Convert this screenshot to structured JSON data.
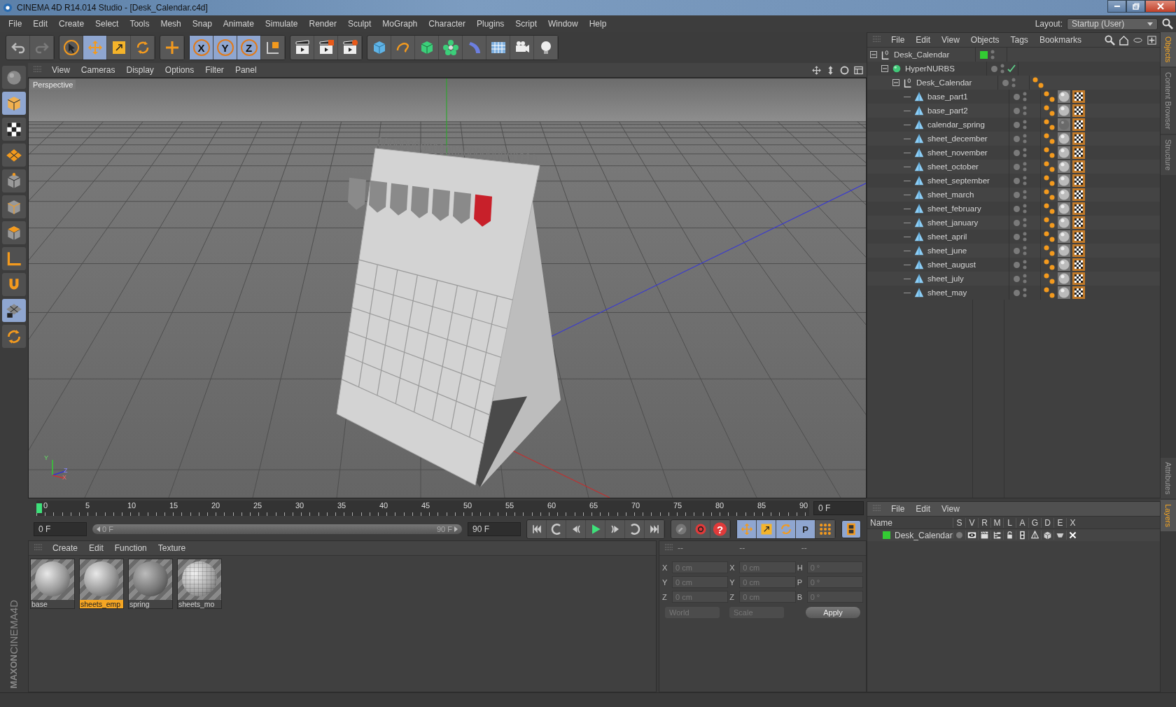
{
  "window": {
    "title": "CINEMA 4D R14.014 Studio - [Desk_Calendar.c4d]"
  },
  "menu_bar": [
    "File",
    "Edit",
    "Create",
    "Select",
    "Tools",
    "Mesh",
    "Snap",
    "Animate",
    "Simulate",
    "Render",
    "Sculpt",
    "MoGraph",
    "Character",
    "Plugins",
    "Script",
    "Window",
    "Help"
  ],
  "layout": {
    "label": "Layout:",
    "value": "Startup (User)"
  },
  "toolbar": [
    {
      "tools": [
        {
          "kind": "undo",
          "disabled": false
        },
        {
          "kind": "redo",
          "disabled": true
        }
      ]
    },
    {
      "tools": [
        {
          "kind": "select",
          "selected": false
        },
        {
          "kind": "move",
          "selected": true
        },
        {
          "kind": "scale",
          "selected": false
        },
        {
          "kind": "rotate",
          "selected": false
        }
      ]
    },
    {
      "tools": [
        {
          "kind": "add",
          "selected": false
        }
      ]
    },
    {
      "tools": [
        {
          "kind": "axis",
          "label": "X",
          "selected": true
        },
        {
          "kind": "axis",
          "label": "Y",
          "selected": true
        },
        {
          "kind": "axis",
          "label": "Z",
          "selected": true
        },
        {
          "kind": "coords",
          "selected": false
        }
      ]
    },
    {
      "tools": [
        {
          "kind": "render-view",
          "selected": false
        },
        {
          "kind": "render-picture",
          "selected": false
        },
        {
          "kind": "render-settings",
          "selected": false
        }
      ]
    },
    {
      "tools": [
        {
          "kind": "cube",
          "selected": false
        },
        {
          "kind": "spline",
          "selected": false
        },
        {
          "kind": "nurbs",
          "selected": false
        },
        {
          "kind": "array",
          "selected": false
        },
        {
          "kind": "deformer",
          "selected": false
        },
        {
          "kind": "floor",
          "selected": false
        },
        {
          "kind": "camera",
          "selected": false
        },
        {
          "kind": "light",
          "selected": false
        }
      ]
    }
  ],
  "left_toolbar": [
    {
      "kind": "make-editable",
      "selected": false
    },
    {
      "kind": "model",
      "selected": true
    },
    {
      "kind": "texture",
      "selected": false
    },
    {
      "kind": "workplane",
      "selected": false
    },
    {
      "kind": "points",
      "selected": false
    },
    {
      "kind": "edges",
      "selected": false
    },
    {
      "kind": "polygons",
      "selected": false
    },
    {
      "kind": "axis-mode",
      "selected": false
    },
    {
      "kind": "snap",
      "selected": false
    },
    {
      "kind": "workplane-lock",
      "selected": true
    },
    {
      "kind": "solo",
      "selected": false
    }
  ],
  "logo": [
    "MAXON",
    "CINEMA4D"
  ],
  "viewport": {
    "menu": [
      "View",
      "Cameras",
      "Display",
      "Options",
      "Filter",
      "Panel"
    ],
    "camera_label": "Perspective",
    "axis_labels": [
      "Y",
      "Z",
      "X"
    ]
  },
  "timeline": {
    "ticks": [
      "0",
      "5",
      "10",
      "15",
      "20",
      "25",
      "30",
      "35",
      "40",
      "45",
      "50",
      "55",
      "60",
      "65",
      "70",
      "75",
      "80",
      "85",
      "90"
    ],
    "level": 0,
    "current_frame": "0 F"
  },
  "controls": {
    "start": "0 F",
    "range": {
      "start": "0 F",
      "end": "90 F",
      "level": 1
    },
    "end": "90 F",
    "transport": [
      {
        "kind": "to-start"
      },
      {
        "kind": "prev-key"
      },
      {
        "kind": "prev-frame"
      },
      {
        "kind": "play"
      },
      {
        "kind": "next-frame"
      },
      {
        "kind": "next-key"
      },
      {
        "kind": "to-end"
      }
    ],
    "record": [
      {
        "kind": "autokey"
      },
      {
        "kind": "record"
      },
      {
        "kind": "help",
        "label": "?"
      }
    ],
    "keys": [
      {
        "kind": "position",
        "selected": true
      },
      {
        "kind": "scale",
        "selected": true
      },
      {
        "kind": "rotation",
        "selected": true
      },
      {
        "kind": "parameter",
        "label": "P",
        "selected": true
      },
      {
        "kind": "point-level",
        "selected": false
      }
    ],
    "timeline_button": {
      "selected": true
    }
  },
  "materials": {
    "menu": [
      "Create",
      "Edit",
      "Function",
      "Texture"
    ],
    "items": [
      {
        "name": "base",
        "kind": "plain",
        "selected": false
      },
      {
        "name": "sheets_emp",
        "kind": "plain",
        "selected": true
      },
      {
        "name": "spring",
        "kind": "dark",
        "selected": false
      },
      {
        "name": "sheets_mo",
        "kind": "textured",
        "selected": false
      }
    ]
  },
  "coordinates": {
    "headers": [
      "--",
      "--",
      "--"
    ],
    "rows": [
      {
        "axis": "X",
        "position": "0 cm",
        "size_axis": "X",
        "size": "0 cm",
        "angle_axis": "H",
        "angle": "0 °"
      },
      {
        "axis": "Y",
        "position": "0 cm",
        "size_axis": "Y",
        "size": "0 cm",
        "angle_axis": "P",
        "angle": "0 °"
      },
      {
        "axis": "Z",
        "position": "0 cm",
        "size_axis": "Z",
        "size": "0 cm",
        "angle_axis": "B",
        "angle": "0 °"
      }
    ],
    "mode": "World",
    "size_mode": "Scale",
    "apply": "Apply"
  },
  "objects": {
    "menu": [
      "File",
      "Edit",
      "View",
      "Objects",
      "Tags",
      "Bookmarks"
    ],
    "tree": [
      {
        "name": "Desk_Calendar",
        "kind": "null",
        "expanded": true,
        "color": "#33cc33",
        "children": [
          {
            "name": "HyperNURBS",
            "kind": "subdivision",
            "expanded": true,
            "enabled": true,
            "children": [
              {
                "name": "Desk_Calendar",
                "kind": "null",
                "expanded": true,
                "tags": [
                  {
                    "kind": "phong"
                  }
                ],
                "children": [
                  {
                    "name": "base_part1",
                    "kind": "polygon",
                    "tags": [
                      {
                        "kind": "phong"
                      },
                      {
                        "kind": "material"
                      },
                      {
                        "kind": "uvw"
                      }
                    ]
                  },
                  {
                    "name": "base_part2",
                    "kind": "polygon",
                    "tags": [
                      {
                        "kind": "phong"
                      },
                      {
                        "kind": "material"
                      },
                      {
                        "kind": "uvw"
                      }
                    ]
                  },
                  {
                    "name": "calendar_spring",
                    "kind": "polygon",
                    "tags": [
                      {
                        "kind": "phong"
                      },
                      {
                        "kind": "dark-material"
                      },
                      {
                        "kind": "uvw"
                      }
                    ]
                  },
                  {
                    "name": "sheet_december",
                    "kind": "polygon",
                    "tags": [
                      {
                        "kind": "phong"
                      },
                      {
                        "kind": "material"
                      },
                      {
                        "kind": "uvw"
                      }
                    ]
                  },
                  {
                    "name": "sheet_november",
                    "kind": "polygon",
                    "tags": [
                      {
                        "kind": "phong"
                      },
                      {
                        "kind": "material"
                      },
                      {
                        "kind": "uvw"
                      }
                    ]
                  },
                  {
                    "name": "sheet_october",
                    "kind": "polygon",
                    "tags": [
                      {
                        "kind": "phong"
                      },
                      {
                        "kind": "material"
                      },
                      {
                        "kind": "uvw"
                      }
                    ]
                  },
                  {
                    "name": "sheet_september",
                    "kind": "polygon",
                    "tags": [
                      {
                        "kind": "phong"
                      },
                      {
                        "kind": "material"
                      },
                      {
                        "kind": "uvw"
                      }
                    ]
                  },
                  {
                    "name": "sheet_march",
                    "kind": "polygon",
                    "tags": [
                      {
                        "kind": "phong"
                      },
                      {
                        "kind": "material"
                      },
                      {
                        "kind": "uvw"
                      }
                    ]
                  },
                  {
                    "name": "sheet_february",
                    "kind": "polygon",
                    "tags": [
                      {
                        "kind": "phong"
                      },
                      {
                        "kind": "material"
                      },
                      {
                        "kind": "uvw"
                      }
                    ]
                  },
                  {
                    "name": "sheet_january",
                    "kind": "polygon",
                    "tags": [
                      {
                        "kind": "phong"
                      },
                      {
                        "kind": "material"
                      },
                      {
                        "kind": "uvw"
                      }
                    ]
                  },
                  {
                    "name": "sheet_april",
                    "kind": "polygon",
                    "tags": [
                      {
                        "kind": "phong"
                      },
                      {
                        "kind": "material"
                      },
                      {
                        "kind": "uvw"
                      }
                    ]
                  },
                  {
                    "name": "sheet_june",
                    "kind": "polygon",
                    "tags": [
                      {
                        "kind": "phong"
                      },
                      {
                        "kind": "material"
                      },
                      {
                        "kind": "uvw"
                      }
                    ]
                  },
                  {
                    "name": "sheet_august",
                    "kind": "polygon",
                    "tags": [
                      {
                        "kind": "phong"
                      },
                      {
                        "kind": "material"
                      },
                      {
                        "kind": "uvw"
                      }
                    ]
                  },
                  {
                    "name": "sheet_july",
                    "kind": "polygon",
                    "tags": [
                      {
                        "kind": "phong"
                      },
                      {
                        "kind": "material"
                      },
                      {
                        "kind": "uvw"
                      }
                    ]
                  },
                  {
                    "name": "sheet_may",
                    "kind": "polygon",
                    "tags": [
                      {
                        "kind": "phong"
                      },
                      {
                        "kind": "material"
                      },
                      {
                        "kind": "uvw"
                      }
                    ]
                  }
                ]
              }
            ]
          }
        ]
      }
    ]
  },
  "layers": {
    "menu": [
      "File",
      "Edit",
      "View"
    ],
    "columns": [
      "Name",
      "S",
      "V",
      "R",
      "M",
      "L",
      "A",
      "G",
      "D",
      "E",
      "X"
    ],
    "items": [
      {
        "name": "Desk_Calendar",
        "color": "#33cc33"
      }
    ]
  },
  "side_tabs": {
    "top": [
      {
        "label": "Objects",
        "selected": true
      },
      {
        "label": "Content Browser",
        "selected": false
      },
      {
        "label": "Structure",
        "selected": false
      }
    ],
    "bottom": [
      {
        "label": "Attributes",
        "selected": false
      },
      {
        "label": "Layers",
        "selected": true
      }
    ]
  }
}
